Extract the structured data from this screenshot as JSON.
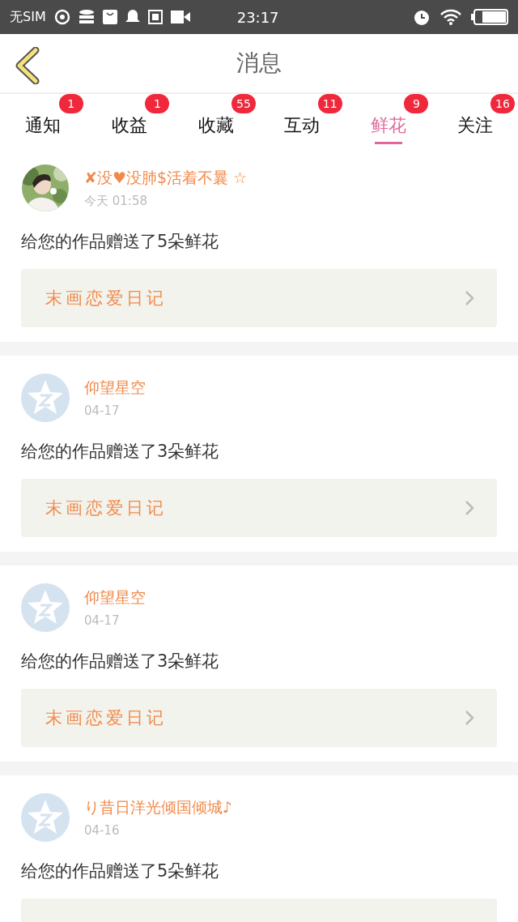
{
  "status_bar": {
    "carrier": "无SIM",
    "time": "23:17"
  },
  "header": {
    "title": "消息"
  },
  "tabs": [
    {
      "label": "通知",
      "badge": "1",
      "selected": false
    },
    {
      "label": "收益",
      "badge": "1",
      "selected": false
    },
    {
      "label": "收藏",
      "badge": "55",
      "selected": false
    },
    {
      "label": "互动",
      "badge": "11",
      "selected": false
    },
    {
      "label": "鲜花",
      "badge": "9",
      "selected": true
    },
    {
      "label": "关注",
      "badge": "16",
      "selected": false
    }
  ],
  "messages": [
    {
      "name": "✘没♥没肺$活着不曩 ☆",
      "time": "今天 01:58",
      "text": "给您的作品赠送了5朵鲜花",
      "work": "末画恋爱日记"
    },
    {
      "kind": "default",
      "name": "仰望星空",
      "time": "04-17",
      "text": "给您的作品赠送了3朵鲜花",
      "work": "末画恋爱日记"
    },
    {
      "kind": "default",
      "name": "仰望星空",
      "time": "04-17",
      "text": "给您的作品赠送了3朵鲜花",
      "work": "末画恋爱日记"
    },
    {
      "kind": "default",
      "name": "り昔日洋光倾国倾城♪",
      "time": "04-16",
      "text": "给您的作品赠送了5朵鲜花"
    }
  ]
}
